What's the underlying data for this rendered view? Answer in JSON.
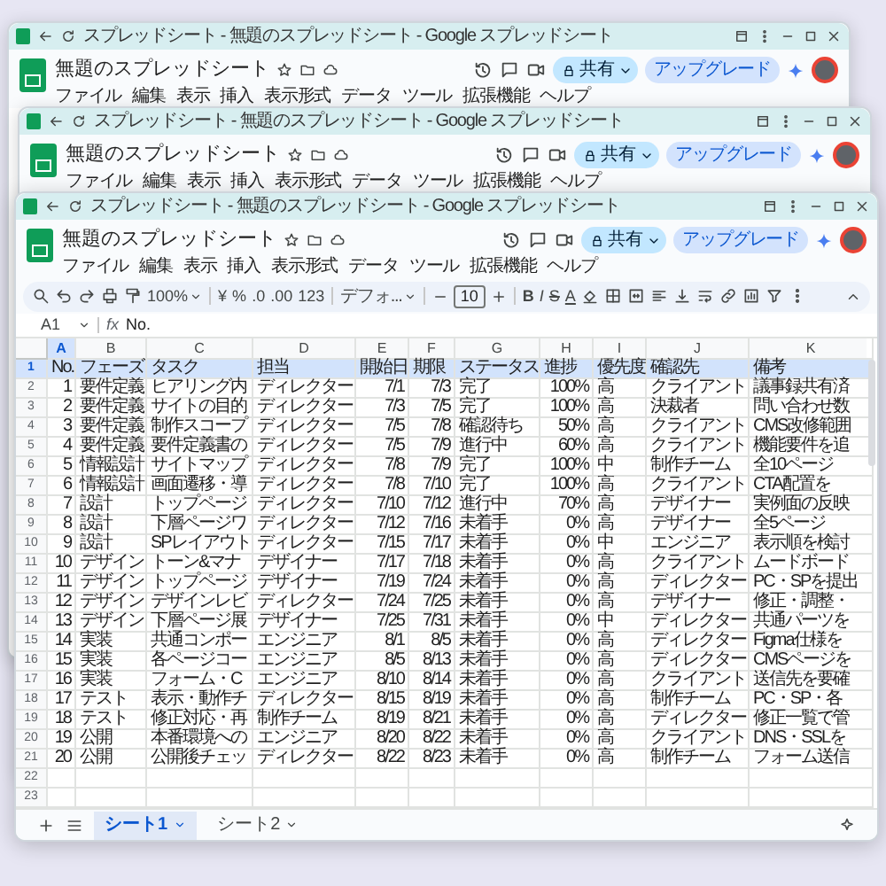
{
  "back_windows": [
    {
      "tab_title": "スプレッドシート - 無題のスプレッドシート - Google スプレッドシート",
      "doc_title": "無題のスプレッドシート",
      "menu": [
        "ファイル",
        "編集",
        "表示",
        "挿入",
        "表示形式",
        "データ",
        "ツール",
        "拡張機能",
        "ヘルプ"
      ],
      "share_label": "共有",
      "upgrade_label": "アップグレード"
    },
    {
      "tab_title": "スプレッドシート - 無題のスプレッドシート - Google スプレッドシート",
      "doc_title": "無題のスプレッドシート",
      "menu": [
        "ファイル",
        "編集",
        "表示",
        "挿入",
        "表示形式",
        "データ",
        "ツール",
        "拡張機能",
        "ヘルプ"
      ],
      "share_label": "共有",
      "upgrade_label": "アップグレード"
    }
  ],
  "window": {
    "tab_title": "スプレッドシート - 無題のスプレッドシート - Google スプレッドシート",
    "doc_title": "無題のスプレッドシート",
    "menu": [
      "ファイル",
      "編集",
      "表示",
      "挿入",
      "表示形式",
      "データ",
      "ツール",
      "拡張機能",
      "ヘルプ"
    ],
    "share_label": "共有",
    "upgrade_label": "アップグレード",
    "toolbar": {
      "zoom": "100%",
      "currency": "¥",
      "percent": "%",
      "decimal_less": ".0",
      "decimal_more": ".00",
      "number_format": "123",
      "font": "デフォ...",
      "font_size": "10",
      "bold": "B",
      "italic": "I",
      "strike": "S",
      "text_color": "A"
    },
    "formula_bar": {
      "cell_ref": "A1",
      "function_symbol": "fx",
      "value": "No."
    },
    "columns": [
      {
        "label": "A",
        "selected": true
      },
      {
        "label": "B",
        "selected": false
      },
      {
        "label": "C",
        "selected": false
      },
      {
        "label": "D",
        "selected": false
      },
      {
        "label": "E",
        "selected": false
      },
      {
        "label": "F",
        "selected": false
      },
      {
        "label": "G",
        "selected": false
      },
      {
        "label": "H",
        "selected": false
      },
      {
        "label": "I",
        "selected": false
      },
      {
        "label": "J",
        "selected": false
      },
      {
        "label": "K",
        "selected": false
      }
    ],
    "rows": [
      {
        "row_number": "1",
        "selected": true,
        "cells": [
          "No.",
          "フェーズ",
          "タスク",
          "担当",
          "開始日",
          "期限",
          "ステータス",
          "進捗",
          "優先度",
          "確認先",
          "備考"
        ]
      },
      {
        "row_number": "2",
        "selected": false,
        "cells": [
          "1",
          "要件定義",
          "ヒアリング内",
          "ディレクター",
          "7/1",
          "7/3",
          "完了",
          "100%",
          "高",
          "クライアント",
          "議事録共有済"
        ]
      },
      {
        "row_number": "3",
        "selected": false,
        "cells": [
          "2",
          "要件定義",
          "サイトの目的",
          "ディレクター",
          "7/3",
          "7/5",
          "完了",
          "100%",
          "高",
          "決裁者",
          "問い合わせ数"
        ]
      },
      {
        "row_number": "4",
        "selected": false,
        "cells": [
          "3",
          "要件定義",
          "制作スコープ",
          "ディレクター",
          "7/5",
          "7/8",
          "確認待ち",
          "50%",
          "高",
          "クライアント",
          "CMS改修範囲"
        ]
      },
      {
        "row_number": "5",
        "selected": false,
        "cells": [
          "4",
          "要件定義",
          "要件定義書の",
          "ディレクター",
          "7/5",
          "7/9",
          "進行中",
          "60%",
          "高",
          "クライアント",
          "機能要件を追"
        ]
      },
      {
        "row_number": "6",
        "selected": false,
        "cells": [
          "5",
          "情報設計",
          "サイトマップ",
          "ディレクター",
          "7/8",
          "7/9",
          "完了",
          "100%",
          "中",
          "制作チーム",
          "全10ページ"
        ]
      },
      {
        "row_number": "7",
        "selected": false,
        "cells": [
          "6",
          "情報設計",
          "画面遷移・導",
          "ディレクター",
          "7/8",
          "7/10",
          "完了",
          "100%",
          "高",
          "クライアント",
          "CTA配置を"
        ]
      },
      {
        "row_number": "8",
        "selected": false,
        "cells": [
          "7",
          "設計",
          "トップページ",
          "ディレクター",
          "7/10",
          "7/12",
          "進行中",
          "70%",
          "高",
          "デザイナー",
          "実例面の反映"
        ]
      },
      {
        "row_number": "9",
        "selected": false,
        "cells": [
          "8",
          "設計",
          "下層ページワ",
          "ディレクター",
          "7/12",
          "7/16",
          "未着手",
          "0%",
          "高",
          "デザイナー",
          "全5ページ"
        ]
      },
      {
        "row_number": "10",
        "selected": false,
        "cells": [
          "9",
          "設計",
          "SPレイアウト",
          "ディレクター",
          "7/15",
          "7/17",
          "未着手",
          "0%",
          "中",
          "エンジニア",
          "表示順を検討"
        ]
      },
      {
        "row_number": "11",
        "selected": false,
        "cells": [
          "10",
          "デザイン",
          "トーン&マナ",
          "デザイナー",
          "7/17",
          "7/18",
          "未着手",
          "0%",
          "高",
          "クライアント",
          "ムードボード"
        ]
      },
      {
        "row_number": "12",
        "selected": false,
        "cells": [
          "11",
          "デザイン",
          "トップページ",
          "デザイナー",
          "7/19",
          "7/24",
          "未着手",
          "0%",
          "高",
          "ディレクター",
          "PC・SPを提出"
        ]
      },
      {
        "row_number": "13",
        "selected": false,
        "cells": [
          "12",
          "デザイン",
          "デザインレビ",
          "ディレクター",
          "7/24",
          "7/25",
          "未着手",
          "0%",
          "高",
          "デザイナー",
          "修正・調整・"
        ]
      },
      {
        "row_number": "14",
        "selected": false,
        "cells": [
          "13",
          "デザイン",
          "下層ページ展",
          "デザイナー",
          "7/25",
          "7/31",
          "未着手",
          "0%",
          "中",
          "ディレクター",
          "共通パーツを"
        ]
      },
      {
        "row_number": "15",
        "selected": false,
        "cells": [
          "14",
          "実装",
          "共通コンポー",
          "エンジニア",
          "8/1",
          "8/5",
          "未着手",
          "0%",
          "高",
          "ディレクター",
          "Figma仕様を"
        ]
      },
      {
        "row_number": "16",
        "selected": false,
        "cells": [
          "15",
          "実装",
          "各ページコー",
          "エンジニア",
          "8/5",
          "8/13",
          "未着手",
          "0%",
          "高",
          "ディレクター",
          "CMSページを"
        ]
      },
      {
        "row_number": "17",
        "selected": false,
        "cells": [
          "16",
          "実装",
          "フォーム・C",
          "エンジニア",
          "8/10",
          "8/14",
          "未着手",
          "0%",
          "高",
          "クライアント",
          "送信先を要確"
        ]
      },
      {
        "row_number": "18",
        "selected": false,
        "cells": [
          "17",
          "テスト",
          "表示・動作チ",
          "ディレクター",
          "8/15",
          "8/19",
          "未着手",
          "0%",
          "高",
          "制作チーム",
          "PC・SP・各"
        ]
      },
      {
        "row_number": "19",
        "selected": false,
        "cells": [
          "18",
          "テスト",
          "修正対応・再",
          "制作チーム",
          "8/19",
          "8/21",
          "未着手",
          "0%",
          "高",
          "ディレクター",
          "修正一覧で管"
        ]
      },
      {
        "row_number": "20",
        "selected": false,
        "cells": [
          "19",
          "公開",
          "本番環境への",
          "エンジニア",
          "8/20",
          "8/22",
          "未着手",
          "0%",
          "高",
          "クライアント",
          "DNS・SSLを"
        ]
      },
      {
        "row_number": "21",
        "selected": false,
        "cells": [
          "20",
          "公開",
          "公開後チェッ",
          "ディレクター",
          "8/22",
          "8/23",
          "未着手",
          "0%",
          "高",
          "制作チーム",
          "フォーム送信"
        ]
      },
      {
        "row_number": "22",
        "selected": false,
        "cells": []
      },
      {
        "row_number": "23",
        "selected": false,
        "cells": []
      }
    ],
    "sheet_tabs": [
      {
        "label": "シート1",
        "selected": true
      },
      {
        "label": "シート2",
        "selected": false
      }
    ]
  }
}
